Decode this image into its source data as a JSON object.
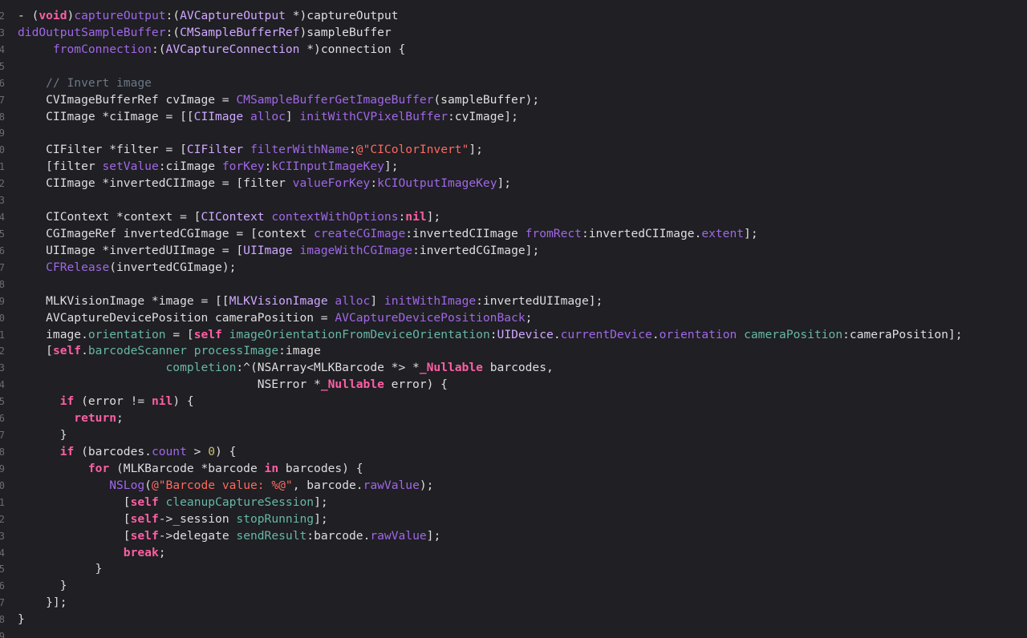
{
  "editor": {
    "theme_colors": {
      "background": "#1f1f24",
      "keyword": "#fc5fa3",
      "type": "#d0a8ff",
      "method": "#a167e6",
      "property": "#67b7a4",
      "string": "#fc6a5d",
      "number": "#d0bf69",
      "comment": "#6c7986",
      "plain": "#dfdfe0",
      "line_number": "#6c6c72"
    },
    "lines": [
      {
        "n": "2",
        "tokens": [
          [
            "plain",
            "- ("
          ],
          [
            "kw",
            "void"
          ],
          [
            "plain",
            ")"
          ],
          [
            "method",
            "captureOutput"
          ],
          [
            "plain",
            ":("
          ],
          [
            "type",
            "AVCaptureOutput"
          ],
          [
            "plain",
            " *)captureOutput"
          ]
        ]
      },
      {
        "n": "3",
        "tokens": [
          [
            "method",
            "didOutputSampleBuffer"
          ],
          [
            "plain",
            ":("
          ],
          [
            "type",
            "CMSampleBufferRef"
          ],
          [
            "plain",
            ")sampleBuffer"
          ]
        ]
      },
      {
        "n": "4",
        "tokens": [
          [
            "plain",
            "     "
          ],
          [
            "method",
            "fromConnection"
          ],
          [
            "plain",
            ":("
          ],
          [
            "type",
            "AVCaptureConnection"
          ],
          [
            "plain",
            " *)connection {"
          ]
        ]
      },
      {
        "n": "5",
        "tokens": []
      },
      {
        "n": "6",
        "tokens": [
          [
            "plain",
            "    "
          ],
          [
            "comment",
            "// Invert image"
          ]
        ]
      },
      {
        "n": "7",
        "tokens": [
          [
            "plain",
            "    CVImageBufferRef cvImage = "
          ],
          [
            "method",
            "CMSampleBufferGetImageBuffer"
          ],
          [
            "plain",
            "(sampleBuffer);"
          ]
        ]
      },
      {
        "n": "8",
        "tokens": [
          [
            "plain",
            "    CIImage *ciImage = [["
          ],
          [
            "type",
            "CIImage"
          ],
          [
            "plain",
            " "
          ],
          [
            "method",
            "alloc"
          ],
          [
            "plain",
            "] "
          ],
          [
            "method",
            "initWithCVPixelBuffer"
          ],
          [
            "plain",
            ":cvImage];"
          ]
        ]
      },
      {
        "n": "9",
        "tokens": []
      },
      {
        "n": "0",
        "tokens": [
          [
            "plain",
            "    CIFilter *filter = ["
          ],
          [
            "type",
            "CIFilter"
          ],
          [
            "plain",
            " "
          ],
          [
            "method",
            "filterWithName"
          ],
          [
            "plain",
            ":"
          ],
          [
            "str",
            "@\"CIColorInvert\""
          ],
          [
            "plain",
            "];"
          ]
        ]
      },
      {
        "n": "1",
        "tokens": [
          [
            "plain",
            "    [filter "
          ],
          [
            "method",
            "setValue"
          ],
          [
            "plain",
            ":ciImage "
          ],
          [
            "method",
            "forKey"
          ],
          [
            "plain",
            ":"
          ],
          [
            "method",
            "kCIInputImageKey"
          ],
          [
            "plain",
            "];"
          ]
        ]
      },
      {
        "n": "2",
        "tokens": [
          [
            "plain",
            "    CIImage *invertedCIImage = [filter "
          ],
          [
            "method",
            "valueForKey"
          ],
          [
            "plain",
            ":"
          ],
          [
            "method",
            "kCIOutputImageKey"
          ],
          [
            "plain",
            "];"
          ]
        ]
      },
      {
        "n": "3",
        "tokens": []
      },
      {
        "n": "4",
        "tokens": [
          [
            "plain",
            "    CIContext *context = ["
          ],
          [
            "type",
            "CIContext"
          ],
          [
            "plain",
            " "
          ],
          [
            "method",
            "contextWithOptions"
          ],
          [
            "plain",
            ":"
          ],
          [
            "kw",
            "nil"
          ],
          [
            "plain",
            "];"
          ]
        ]
      },
      {
        "n": "5",
        "tokens": [
          [
            "plain",
            "    CGImageRef invertedCGImage = [context "
          ],
          [
            "method",
            "createCGImage"
          ],
          [
            "plain",
            ":invertedCIImage "
          ],
          [
            "method",
            "fromRect"
          ],
          [
            "plain",
            ":invertedCIImage."
          ],
          [
            "method",
            "extent"
          ],
          [
            "plain",
            "];"
          ]
        ]
      },
      {
        "n": "6",
        "tokens": [
          [
            "plain",
            "    UIImage *invertedUIImage = ["
          ],
          [
            "type",
            "UIImage"
          ],
          [
            "plain",
            " "
          ],
          [
            "method",
            "imageWithCGImage"
          ],
          [
            "plain",
            ":invertedCGImage];"
          ]
        ]
      },
      {
        "n": "7",
        "tokens": [
          [
            "plain",
            "    "
          ],
          [
            "method",
            "CFRelease"
          ],
          [
            "plain",
            "(invertedCGImage);"
          ]
        ]
      },
      {
        "n": "8",
        "tokens": []
      },
      {
        "n": "9",
        "tokens": [
          [
            "plain",
            "    MLKVisionImage *image = [["
          ],
          [
            "type",
            "MLKVisionImage"
          ],
          [
            "plain",
            " "
          ],
          [
            "method",
            "alloc"
          ],
          [
            "plain",
            "] "
          ],
          [
            "method",
            "initWithImage"
          ],
          [
            "plain",
            ":invertedUIImage];"
          ]
        ]
      },
      {
        "n": "0",
        "tokens": [
          [
            "plain",
            "    AVCaptureDevicePosition cameraPosition = "
          ],
          [
            "method",
            "AVCaptureDevicePositionBack"
          ],
          [
            "plain",
            ";"
          ]
        ]
      },
      {
        "n": "1",
        "tokens": [
          [
            "plain",
            "    image."
          ],
          [
            "prop",
            "orientation"
          ],
          [
            "plain",
            " = ["
          ],
          [
            "kw",
            "self"
          ],
          [
            "plain",
            " "
          ],
          [
            "prop",
            "imageOrientationFromDeviceOrientation"
          ],
          [
            "plain",
            ":"
          ],
          [
            "type",
            "UIDevice"
          ],
          [
            "plain",
            "."
          ],
          [
            "method",
            "currentDevice"
          ],
          [
            "plain",
            "."
          ],
          [
            "method",
            "orientation"
          ],
          [
            "plain",
            " "
          ],
          [
            "prop",
            "cameraPosition"
          ],
          [
            "plain",
            ":cameraPosition];"
          ]
        ]
      },
      {
        "n": "2",
        "tokens": [
          [
            "plain",
            "    ["
          ],
          [
            "kw",
            "self"
          ],
          [
            "plain",
            "."
          ],
          [
            "prop",
            "barcodeScanner"
          ],
          [
            "plain",
            " "
          ],
          [
            "prop",
            "processImage"
          ],
          [
            "plain",
            ":image"
          ]
        ]
      },
      {
        "n": "3",
        "tokens": [
          [
            "plain",
            "                     "
          ],
          [
            "prop",
            "completion"
          ],
          [
            "plain",
            ":^(NSArray<MLKBarcode *> *"
          ],
          [
            "kw",
            "_Nullable"
          ],
          [
            "plain",
            " barcodes,"
          ]
        ]
      },
      {
        "n": "4",
        "tokens": [
          [
            "plain",
            "                                  NSError *"
          ],
          [
            "kw",
            "_Nullable"
          ],
          [
            "plain",
            " error) {"
          ]
        ]
      },
      {
        "n": "5",
        "tokens": [
          [
            "plain",
            "      "
          ],
          [
            "kw",
            "if"
          ],
          [
            "plain",
            " (error != "
          ],
          [
            "kw",
            "nil"
          ],
          [
            "plain",
            ") {"
          ]
        ]
      },
      {
        "n": "6",
        "tokens": [
          [
            "plain",
            "        "
          ],
          [
            "kw",
            "return"
          ],
          [
            "plain",
            ";"
          ]
        ]
      },
      {
        "n": "7",
        "tokens": [
          [
            "plain",
            "      }"
          ]
        ]
      },
      {
        "n": "8",
        "tokens": [
          [
            "plain",
            "      "
          ],
          [
            "kw",
            "if"
          ],
          [
            "plain",
            " (barcodes."
          ],
          [
            "method",
            "count"
          ],
          [
            "plain",
            " > "
          ],
          [
            "num",
            "0"
          ],
          [
            "plain",
            ") {"
          ]
        ]
      },
      {
        "n": "9",
        "tokens": [
          [
            "plain",
            "          "
          ],
          [
            "kw",
            "for"
          ],
          [
            "plain",
            " (MLKBarcode *barcode "
          ],
          [
            "kw",
            "in"
          ],
          [
            "plain",
            " barcodes) {"
          ]
        ]
      },
      {
        "n": "0",
        "tokens": [
          [
            "plain",
            "             "
          ],
          [
            "method",
            "NSLog"
          ],
          [
            "plain",
            "("
          ],
          [
            "str",
            "@\"Barcode value: %@\""
          ],
          [
            "plain",
            ", barcode."
          ],
          [
            "method",
            "rawValue"
          ],
          [
            "plain",
            ");"
          ]
        ]
      },
      {
        "n": "1",
        "tokens": [
          [
            "plain",
            "               ["
          ],
          [
            "kw",
            "self"
          ],
          [
            "plain",
            " "
          ],
          [
            "prop",
            "cleanupCaptureSession"
          ],
          [
            "plain",
            "];"
          ]
        ]
      },
      {
        "n": "2",
        "tokens": [
          [
            "plain",
            "               ["
          ],
          [
            "kw",
            "self"
          ],
          [
            "plain",
            "->_session "
          ],
          [
            "prop",
            "stopRunning"
          ],
          [
            "plain",
            "];"
          ]
        ]
      },
      {
        "n": "3",
        "tokens": [
          [
            "plain",
            "               ["
          ],
          [
            "kw",
            "self"
          ],
          [
            "plain",
            "->delegate "
          ],
          [
            "prop",
            "sendResult"
          ],
          [
            "plain",
            ":barcode."
          ],
          [
            "method",
            "rawValue"
          ],
          [
            "plain",
            "];"
          ]
        ]
      },
      {
        "n": "4",
        "tokens": [
          [
            "plain",
            "               "
          ],
          [
            "kw",
            "break"
          ],
          [
            "plain",
            ";"
          ]
        ]
      },
      {
        "n": "5",
        "tokens": [
          [
            "plain",
            "           }"
          ]
        ]
      },
      {
        "n": "6",
        "tokens": [
          [
            "plain",
            "      }"
          ]
        ]
      },
      {
        "n": "7",
        "tokens": [
          [
            "plain",
            "    }];"
          ]
        ]
      },
      {
        "n": "8",
        "tokens": [
          [
            "plain",
            "}"
          ]
        ]
      },
      {
        "n": "9",
        "tokens": []
      }
    ]
  }
}
